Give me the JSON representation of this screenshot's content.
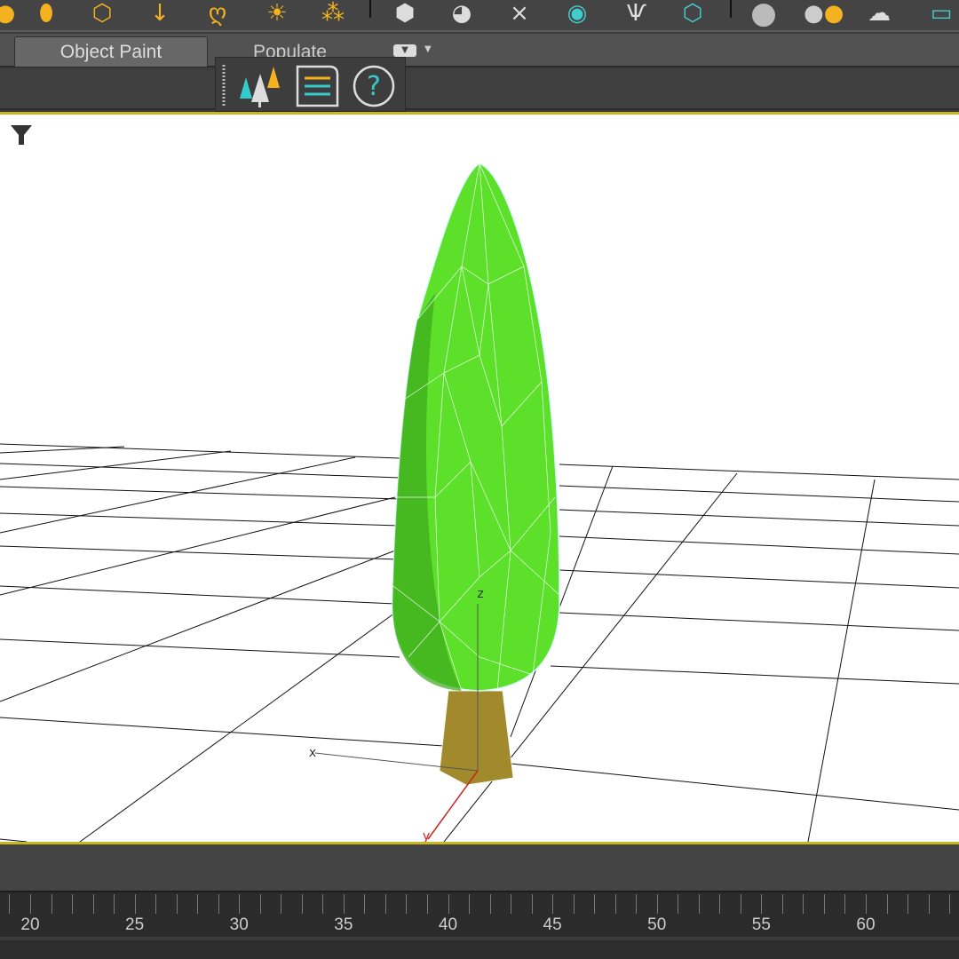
{
  "toolbar": {
    "icons": [
      "teapot-icon",
      "icosahedron-icon",
      "arrow-down-icon",
      "lightbulb-icon",
      "sun-icon",
      "skylight-icon",
      "box-icon",
      "camera-icon",
      "tower-icon",
      "projector-icon",
      "grass-icon",
      "fire-icon",
      "sphere-material-icon",
      "material-pair-icon",
      "cloud-icon",
      "render-setup-icon"
    ]
  },
  "tabs": {
    "object_paint": "Object Paint",
    "populate": "Populate"
  },
  "flyout": {
    "icons": [
      "forest-icon",
      "list-icon",
      "help-icon"
    ]
  },
  "viewport": {
    "axis_x": "x",
    "axis_y": "y",
    "axis_z": "z",
    "colors": {
      "crown": "#5ce02a",
      "trunk": "#a08a2c",
      "border": "#c8b820"
    }
  },
  "timeline": {
    "labels": [
      "20",
      "25",
      "30",
      "35",
      "40",
      "45",
      "50",
      "55",
      "60"
    ]
  }
}
